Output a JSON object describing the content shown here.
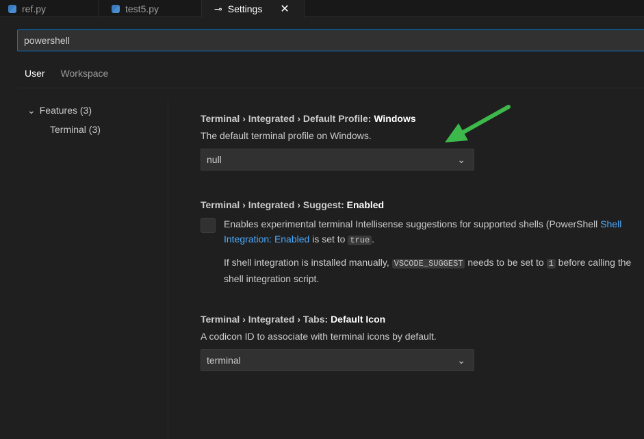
{
  "tabs": [
    {
      "label": "ref.py",
      "icon": "python-icon"
    },
    {
      "label": "test5.py",
      "icon": "python-icon"
    },
    {
      "label": "Settings",
      "icon": "settings-icon",
      "active": true
    }
  ],
  "search": {
    "value": "powershell"
  },
  "scope_tabs": [
    "User",
    "Workspace"
  ],
  "toc": {
    "features": "Features (3)",
    "terminal": "Terminal (3)"
  },
  "settings": [
    {
      "prefix": "Terminal › Integrated › Default Profile: ",
      "name": "Windows",
      "description": "The default terminal profile on Windows.",
      "value": "null"
    },
    {
      "prefix": "Terminal › Integrated › Suggest: ",
      "name": "Enabled",
      "checked": false,
      "desc1": "Enables experimental terminal Intellisense suggestions for supported shells (PowerShell",
      "link": "Shell Integration: Enabled",
      "desc2": " is set to ",
      "code1": "true",
      "desc3": ".",
      "desc4": "If shell integration is installed manually, ",
      "code2": "VSCODE_SUGGEST",
      "desc5": " needs to be set to ",
      "code3": "1",
      "desc6": " before calling the shell integration",
      "desc7": "script."
    },
    {
      "prefix": "Terminal › Integrated › Tabs: ",
      "name": "Default Icon",
      "description": "A codicon ID to associate with terminal icons by default.",
      "value": "terminal"
    }
  ],
  "colors": {
    "accent": "#0078d4",
    "link": "#4daafc",
    "annotation_arrow": "#3cb94a"
  }
}
